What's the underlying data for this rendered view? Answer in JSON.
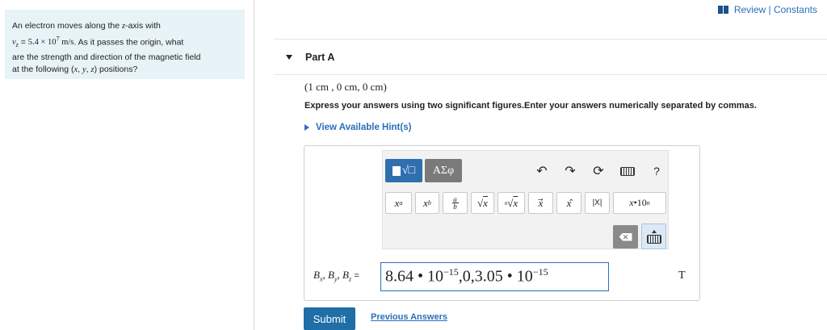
{
  "problem": {
    "line1": "An electron moves along the z-axis with",
    "line2": "v_z = 5.4 × 10^7 m/s. As it passes the origin, what",
    "line3": "are the strength and direction of the magnetic field",
    "line4": "at the following (x, y, z) positions?"
  },
  "header": {
    "review_constants": "Review | Constants"
  },
  "part": {
    "label": "Part A"
  },
  "question": {
    "position": "(1 cm , 0 cm, 0 cm)",
    "instructions": "Express your answers using two significant figures.Enter your answers numerically separated by commas.",
    "hint_link": "View Available Hint(s)"
  },
  "toolbar": {
    "template_button_icon": "square-root-template-icon",
    "greek_button_label": "ΑΣφ",
    "undo_icon": "undo-arrow-icon",
    "redo_icon": "redo-arrow-icon",
    "reset_icon": "reset-icon",
    "keyboard_shortcuts_icon": "keyboard-icon",
    "help_label": "?",
    "symbols": [
      "xᵃ",
      "x_b",
      "a/b",
      "√x",
      "ⁿ√x",
      "x⃗",
      "x̂",
      "|X|",
      "x•10ⁿ"
    ],
    "delete_icon": "backspace-icon",
    "keyboard_toggle_icon": "keyboard-up-icon"
  },
  "answer": {
    "variable_label": "B_x, B_y, B_z =",
    "value": "8.64 • 10^−15,0,3.05 • 10^−15",
    "unit": "T"
  },
  "actions": {
    "submit_label": "Submit",
    "previous_answers_label": "Previous Answers"
  }
}
